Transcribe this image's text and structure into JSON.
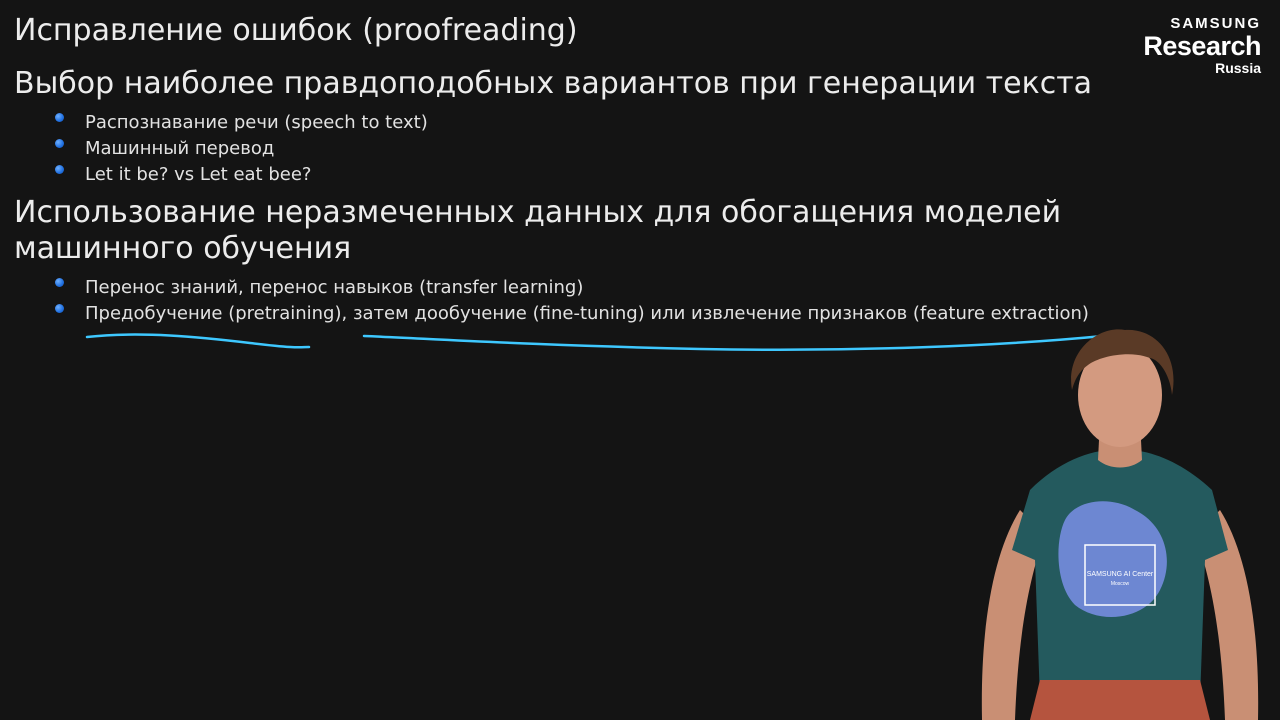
{
  "slide": {
    "headings": [
      "Исправление ошибок (proofreading)",
      "Выбор наиболее правдоподобных вариантов при генерации текста",
      "Использование неразмеченных данных для обогащения моделей машинного обучения"
    ],
    "list_generation": [
      "Распознавание речи (speech to text)",
      "Машинный перевод",
      "Let it be? vs Let eat bee?"
    ],
    "list_unlabeled": [
      "Перенос знаний, перенос навыков (transfer learning)",
      "Предобучение (pretraining), затем дообучение (fine-tuning) или извлечение признаков (feature extraction)"
    ]
  },
  "logo": {
    "brand": "SAMSUNG",
    "main": "Research",
    "sub": "Russia"
  },
  "presenter": {
    "shirt_text": "SAMSUNG AI Center",
    "shirt_subtext": "Moscow"
  },
  "colors": {
    "background": "#141414",
    "text": "#e8e8e8",
    "bullet": "#1f6fe0",
    "annotation": "#3ec8ff"
  }
}
